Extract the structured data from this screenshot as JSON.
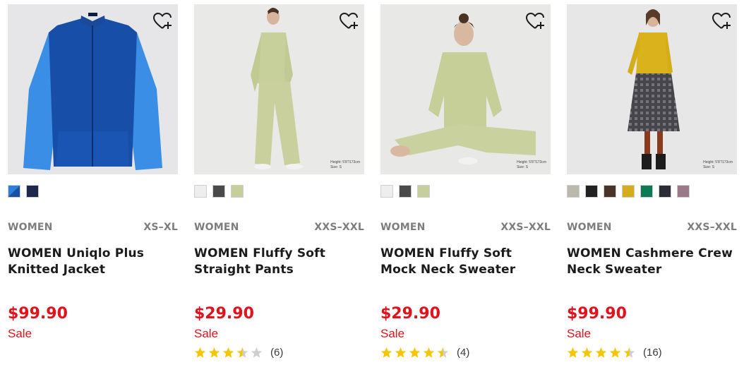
{
  "colors": {
    "price": "#e0121b",
    "star": "#f7c400",
    "star_empty": "#cfcfcf",
    "meta": "#7d7d7d"
  },
  "products": [
    {
      "gender": "WOMEN",
      "sizes": "XS–XL",
      "name": "WOMEN Uniqlo Plus Knitted Jacket",
      "price": "$99.90",
      "sale": "Sale",
      "swatches": [
        "#2e7fd8",
        "#1d2a4e"
      ],
      "rating": null,
      "count": null
    },
    {
      "gender": "WOMEN",
      "sizes": "XXS–XXL",
      "name": "WOMEN Fluffy Soft Straight Pants",
      "price": "$29.90",
      "sale": "Sale",
      "swatches": [
        "#eeeeee",
        "#4a4a4a",
        "#c6cf9b"
      ],
      "photo_tag": [
        "Height: 5'8\"/173cm",
        "Size: S"
      ],
      "rating": 3.5,
      "count": "(6)"
    },
    {
      "gender": "WOMEN",
      "sizes": "XXS–XXL",
      "name": "WOMEN Fluffy Soft Mock Neck Sweater",
      "price": "$29.90",
      "sale": "Sale",
      "swatches": [
        "#eeeeee",
        "#4a4a4a",
        "#c6cf9b"
      ],
      "photo_tag": [
        "Height: 5'8\"/173cm",
        "Size: S"
      ],
      "rating": 4.5,
      "count": "(4)"
    },
    {
      "gender": "WOMEN",
      "sizes": "XXS–XXL",
      "name": "WOMEN Cashmere Crew Neck Sweater",
      "price": "$99.90",
      "sale": "Sale",
      "swatches": [
        "#bdb8ac",
        "#222222",
        "#4a3328",
        "#d4ac1e",
        "#0e7a55",
        "#2a2d36",
        "#9a7a88"
      ],
      "photo_tag": [
        "Height: 5'8\"/173cm",
        "Size: S"
      ],
      "rating": 4.5,
      "count": "(16)"
    }
  ]
}
